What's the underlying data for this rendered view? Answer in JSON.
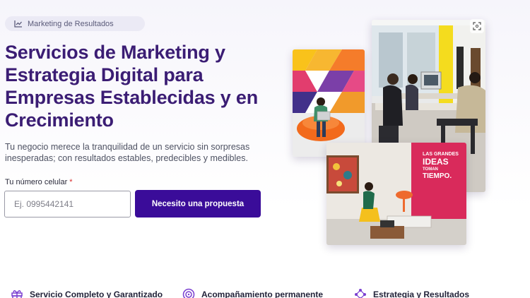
{
  "badge": {
    "label": "Marketing de Resultados",
    "icon": "chart-line-icon"
  },
  "hero": {
    "title": "Servicios de Marketing y Estrategia Digital para Empresas Establecidas y en Crecimiento",
    "subtitle": "Tu negocio merece la tranquilidad de un servicio sin sorpresas inesperadas; con resultados estables,  predecibles y medibles."
  },
  "form": {
    "phone_label": "Tu número celular",
    "required_mark": "*",
    "phone_placeholder": "Ej. 0995442141",
    "submit_label": "Necesito una propuesta"
  },
  "gallery": {
    "wall_sign_line1": "LAS GRANDES",
    "wall_sign_line2": "IDEAS",
    "wall_sign_line3": "TOMAN",
    "wall_sign_line4": "TIEMPO.",
    "expand_icon": "expand-icon"
  },
  "features": [
    {
      "label": "Servicio Completo y Garantizado",
      "icon": "gift-icon"
    },
    {
      "label": "Acompañamiento permanente",
      "icon": "target-icon"
    },
    {
      "label": "Estrategia y Resultados",
      "icon": "network-icon"
    }
  ],
  "colors": {
    "brand_primary": "#3a0c99",
    "title_color": "#3b1d74",
    "feature_icon": "#7a3fd0"
  }
}
